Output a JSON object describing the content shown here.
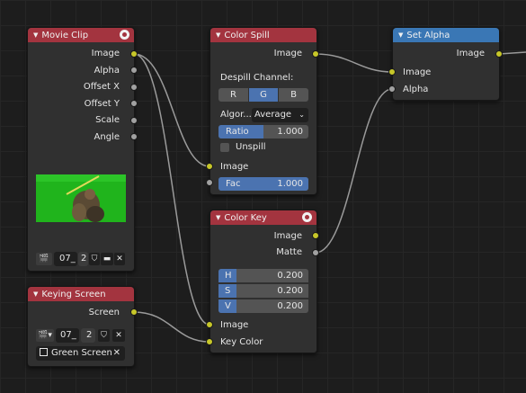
{
  "movie_clip": {
    "title": "Movie Clip",
    "outputs": [
      "Image",
      "Alpha",
      "Offset X",
      "Offset Y",
      "Scale",
      "Angle"
    ],
    "clip_name": "07_",
    "users": "2"
  },
  "keying_screen": {
    "title": "Keying Screen",
    "output": "Screen",
    "clip_name": "07_",
    "users": "2",
    "tracking_object": "Green Screen"
  },
  "color_spill": {
    "title": "Color Spill",
    "output": "Image",
    "despill_label": "Despill Channel:",
    "channels": [
      "R",
      "G",
      "B"
    ],
    "active_channel": "G",
    "algorithm_label": "Algor...",
    "algorithm_value": "Average",
    "ratio_label": "Ratio",
    "ratio_value": "1.000",
    "unspill_label": "Unspill",
    "input_image": "Image",
    "fac_label": "Fac",
    "fac_value": "1.000"
  },
  "color_key": {
    "title": "Color Key",
    "outputs": [
      "Image",
      "Matte"
    ],
    "h_label": "H",
    "h_value": "0.200",
    "s_label": "S",
    "s_value": "0.200",
    "v_label": "V",
    "v_value": "0.200",
    "inputs": [
      "Image",
      "Key Color"
    ]
  },
  "set_alpha": {
    "title": "Set Alpha",
    "output": "Image",
    "inputs": [
      "Image",
      "Alpha"
    ]
  },
  "colors": {
    "header_input": "#a3343f",
    "header_converter": "#3a77b5",
    "socket_color": "#c7c729",
    "socket_value": "#a1a1a1",
    "value_fill": "#4b73b0"
  }
}
